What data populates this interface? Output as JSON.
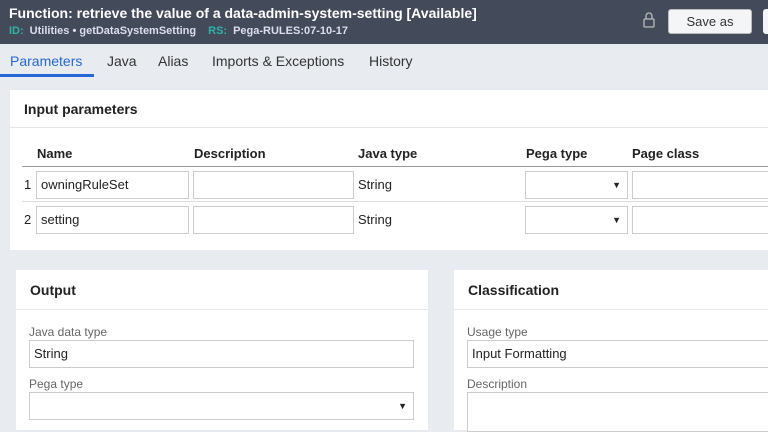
{
  "header": {
    "title": "Function:  retrieve the value of a data-admin-system-setting [Available]",
    "id_label": "ID:",
    "id_value": "Utilities • getDataSystemSetting",
    "rs_label": "RS:",
    "rs_value": "Pega-RULES:07-10-17",
    "save_as": "Save as"
  },
  "tabs": [
    "Parameters",
    "Java",
    "Alias",
    "Imports & Exceptions",
    "History"
  ],
  "input_params": {
    "title": "Input parameters",
    "columns": [
      "Name",
      "Description",
      "Java type",
      "Pega type",
      "Page class"
    ],
    "rows": [
      {
        "num": "1",
        "name": "owningRuleSet",
        "description": "",
        "java_type": "String",
        "pega_type": ""
      },
      {
        "num": "2",
        "name": "setting",
        "description": "",
        "java_type": "String",
        "pega_type": ""
      }
    ]
  },
  "output": {
    "title": "Output",
    "java_label": "Java data type",
    "java_value": "String",
    "pega_label": "Pega type",
    "pega_value": ""
  },
  "classification": {
    "title": "Classification",
    "usage_label": "Usage type",
    "usage_value": "Input Formatting",
    "desc_label": "Description"
  }
}
